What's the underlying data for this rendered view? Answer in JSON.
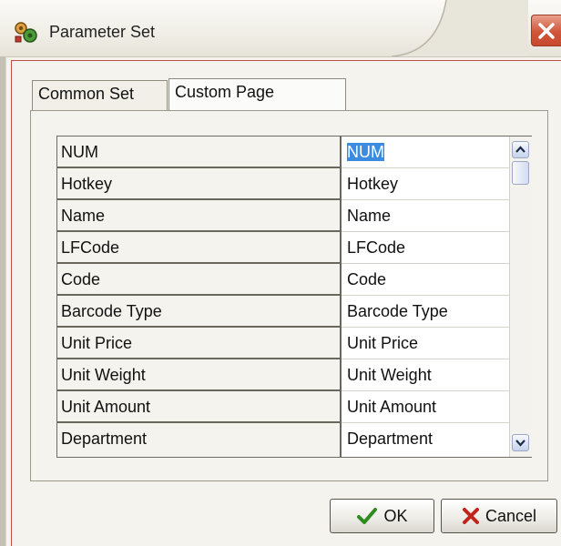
{
  "window": {
    "title": "Parameter Set",
    "icon": "parameter-set-app-icon",
    "close_icon": "close-icon",
    "accent_close": "#d1553a"
  },
  "tabs": [
    {
      "label": "Common Set",
      "active": false
    },
    {
      "label": "Custom Page",
      "active": true
    }
  ],
  "grid": {
    "rows": [
      {
        "name": "NUM",
        "value": "NUM",
        "selected": true
      },
      {
        "name": "Hotkey",
        "value": "Hotkey"
      },
      {
        "name": "Name",
        "value": "Name"
      },
      {
        "name": "LFCode",
        "value": "LFCode"
      },
      {
        "name": "Code",
        "value": "Code"
      },
      {
        "name": "Barcode Type",
        "value": "Barcode Type"
      },
      {
        "name": "Unit Price",
        "value": "Unit Price"
      },
      {
        "name": "Unit Weight",
        "value": "Unit Weight"
      },
      {
        "name": "Unit Amount",
        "value": "Unit Amount"
      },
      {
        "name": "Department",
        "value": "Department"
      }
    ],
    "selection_color": "#3b8ce0"
  },
  "buttons": {
    "ok_label": "OK",
    "cancel_label": "Cancel",
    "ok_icon": "checkmark-icon",
    "cancel_icon": "x-mark-icon"
  }
}
